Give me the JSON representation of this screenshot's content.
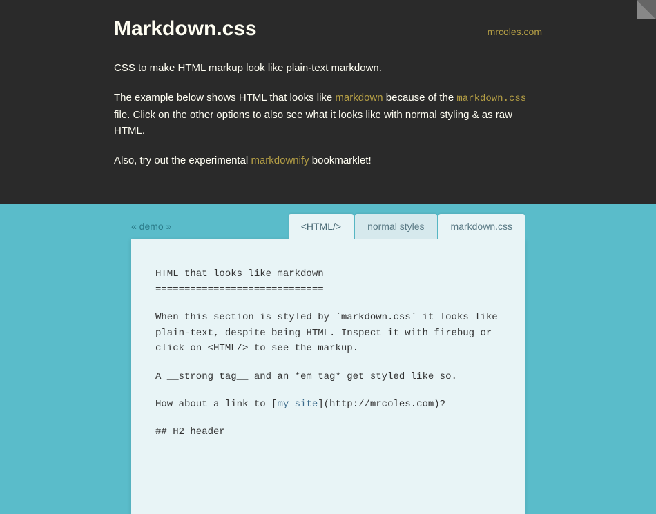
{
  "header": {
    "title": "Markdown.css",
    "siteLink": "mrcoles.com",
    "intro1": "CSS to make HTML markup look like plain-text markdown.",
    "intro2a": "The example below shows HTML that looks like ",
    "intro2link": "markdown",
    "intro2b": " because of the ",
    "intro2code": "markdown.css",
    "intro2c": " file. Click on the other options to also see what it looks like with normal styling & as raw HTML.",
    "intro3a": "Also, try out the experimental ",
    "intro3link": "markdownify",
    "intro3b": " bookmarklet!"
  },
  "tabs": {
    "demoLabel": "« demo »",
    "tab1": "<HTML/>",
    "tab2": "normal styles",
    "tab3": "markdown.css"
  },
  "content": {
    "h1": "HTML that looks like markdown",
    "hr": "=============================",
    "p1": "When this section is styled by `markdown.css` it looks like plain-text, despite being HTML. Inspect it with firebug or click on <HTML/> to see the markup.",
    "p2": "A __strong tag__ and an *em tag* get styled like so.",
    "p3a": "How about a link to [",
    "p3link": "my site",
    "p3b": "](http://mrcoles.com)?",
    "h2": "## H2 header"
  }
}
